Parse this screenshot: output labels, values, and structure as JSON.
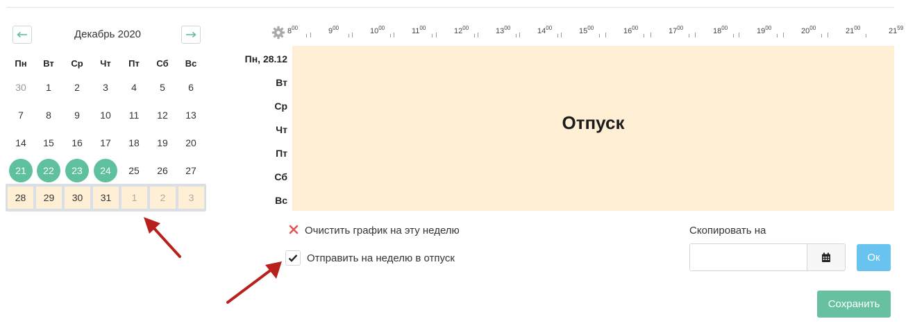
{
  "calendar": {
    "month_title": "Декабрь 2020",
    "prev_icon": "arrow-left-icon",
    "next_icon": "arrow-right-icon",
    "weekdays": [
      "Пн",
      "Вт",
      "Ср",
      "Чт",
      "Пт",
      "Сб",
      "Вс"
    ],
    "weeks": [
      [
        "30",
        "1",
        "2",
        "3",
        "4",
        "5",
        "6"
      ],
      [
        "7",
        "8",
        "9",
        "10",
        "11",
        "12",
        "13"
      ],
      [
        "14",
        "15",
        "16",
        "17",
        "18",
        "19",
        "20"
      ],
      [
        "21",
        "22",
        "23",
        "24",
        "25",
        "26",
        "27"
      ],
      [
        "28",
        "29",
        "30",
        "31",
        "1",
        "2",
        "3"
      ]
    ],
    "highlighted_days": [
      "21",
      "22",
      "23",
      "24"
    ],
    "selected_week_index": 4
  },
  "schedule": {
    "settings_icon": "gear-icon",
    "hours": [
      "8",
      "9",
      "10",
      "11",
      "12",
      "13",
      "14",
      "15",
      "16",
      "17",
      "18",
      "19",
      "20",
      "21"
    ],
    "hours_minutes": "00",
    "end_hour": "21",
    "end_minutes": "59",
    "rows": [
      "Пн, 28.12",
      "Вт",
      "Ср",
      "Чт",
      "Пт",
      "Сб",
      "Вс"
    ],
    "block_label": "Отпуск"
  },
  "actions": {
    "clear_icon": "close-icon",
    "clear_label": "Очистить график на эту неделю",
    "vacation_label": "Отправить на неделю в отпуск",
    "vacation_checked": true,
    "copy_label": "Скопировать на",
    "copy_value": "",
    "calendar_icon": "calendar-icon",
    "ok_label": "Ок",
    "save_label": "Сохранить"
  },
  "colors": {
    "accent_green": "#5fc09d",
    "vacation_fill": "#fff0d5",
    "ok_blue": "#68c3ee",
    "annotation_red": "#b8201c"
  }
}
